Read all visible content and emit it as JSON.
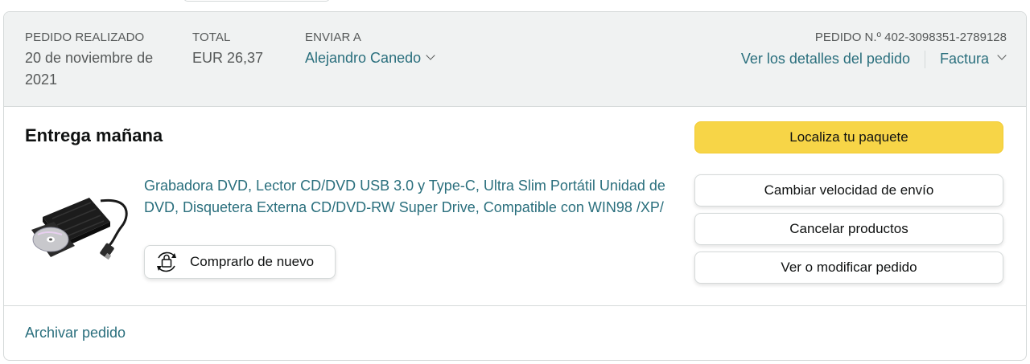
{
  "header": {
    "placed_label": "PEDIDO REALIZADO",
    "placed_date_line1": "20 de noviembre de",
    "placed_date_line2": "2021",
    "total_label": "TOTAL",
    "total_value": "EUR 26,37",
    "ship_to_label": "ENVIAR A",
    "ship_to_name": "Alejandro Canedo",
    "order_number": "PEDIDO N.º 402-3098351-2789128",
    "details_link": "Ver los detalles del pedido",
    "invoice_link": "Factura"
  },
  "shipment": {
    "status": "Entrega mañana",
    "product_title": "Grabadora DVD, Lector CD/DVD USB 3.0 y Type-C, Ultra Slim Portátil Unidad de DVD, Disquetera Externa CD/DVD-RW Super Drive, Compatible con WIN98 /XP/",
    "buy_again_label": "Comprarlo de nuevo",
    "buy_again_icon": "buy-again-icon",
    "product_image": "external-dvd-drive"
  },
  "actions": {
    "track": "Localiza tu paquete",
    "change_speed": "Cambiar velocidad de envío",
    "cancel": "Cancelar productos",
    "view_edit": "Ver o modificar pedido"
  },
  "footer": {
    "archive": "Archivar pedido"
  },
  "colors": {
    "link": "#2a6f7d",
    "primary_button": "#f7d547",
    "header_bg": "#f0f2f2",
    "border": "#d5d9d9"
  }
}
